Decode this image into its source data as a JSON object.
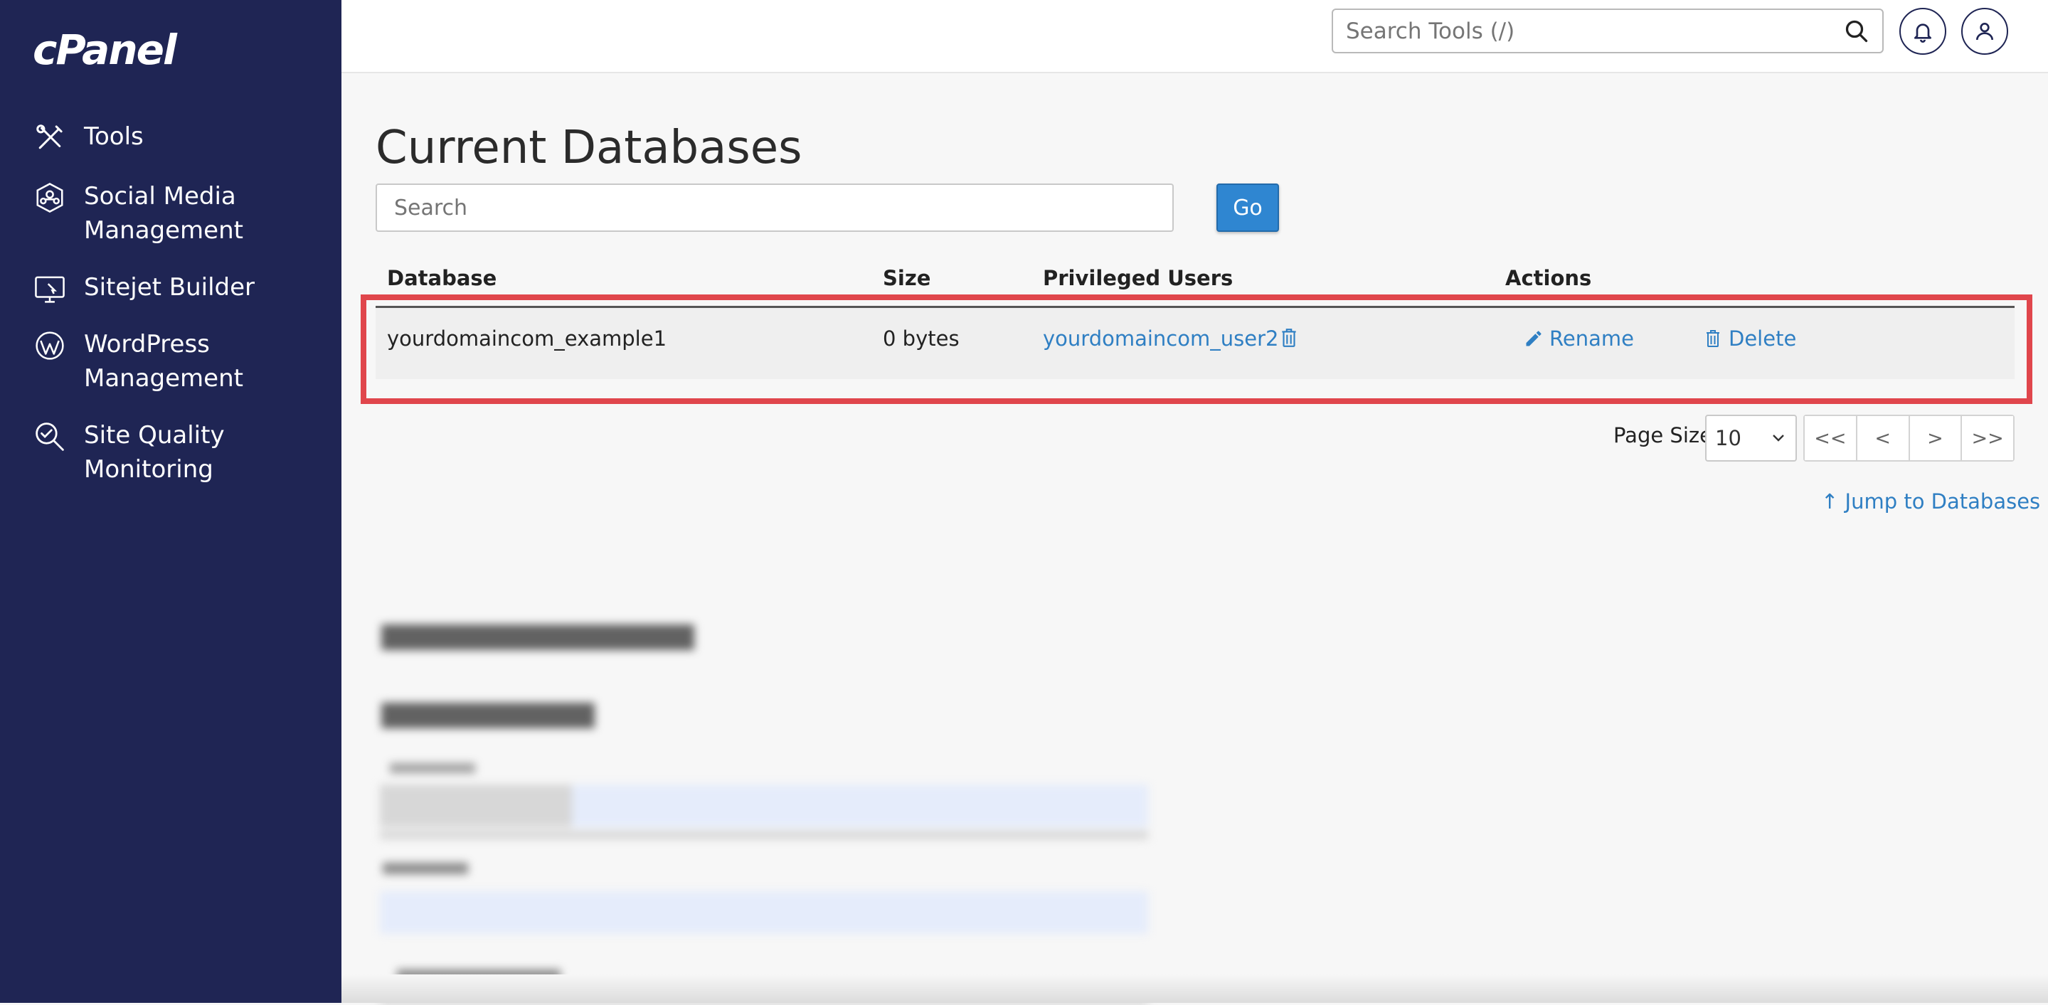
{
  "brand": "cPanel",
  "sidebar": {
    "items": [
      {
        "label": "Tools",
        "icon": "tools-icon"
      },
      {
        "label": "Social Media\nManagement",
        "line1": "Social Media",
        "line2": "Management",
        "icon": "social-media-icon"
      },
      {
        "label": "Sitejet Builder",
        "icon": "sitejet-icon"
      },
      {
        "label": "WordPress Management",
        "line1": "WordPress",
        "line2": "Management",
        "icon": "wordpress-icon"
      },
      {
        "label": "Site Quality Monitoring",
        "line1": "Site Quality",
        "line2": "Monitoring",
        "icon": "site-quality-icon"
      }
    ]
  },
  "topbar": {
    "search_placeholder": "Search Tools (/)"
  },
  "main": {
    "title": "Current Databases",
    "search_placeholder": "Search",
    "go_label": "Go",
    "columns": [
      "Database",
      "Size",
      "Privileged Users",
      "Actions"
    ],
    "rows": [
      {
        "database": "yourdomaincom_example1",
        "size": "0 bytes",
        "user": "yourdomaincom_user2",
        "rename": "Rename",
        "delete": "Delete"
      }
    ],
    "page_size_label": "Page Size",
    "page_size_value": "10",
    "pager": [
      "<<",
      "<",
      ">",
      ">>"
    ],
    "jump_label": "Jump to Databases"
  },
  "colors": {
    "sidebar": "#1f2554",
    "link": "#2f7fc3",
    "primary_button": "#2f86d1",
    "highlight": "#e0464c"
  }
}
